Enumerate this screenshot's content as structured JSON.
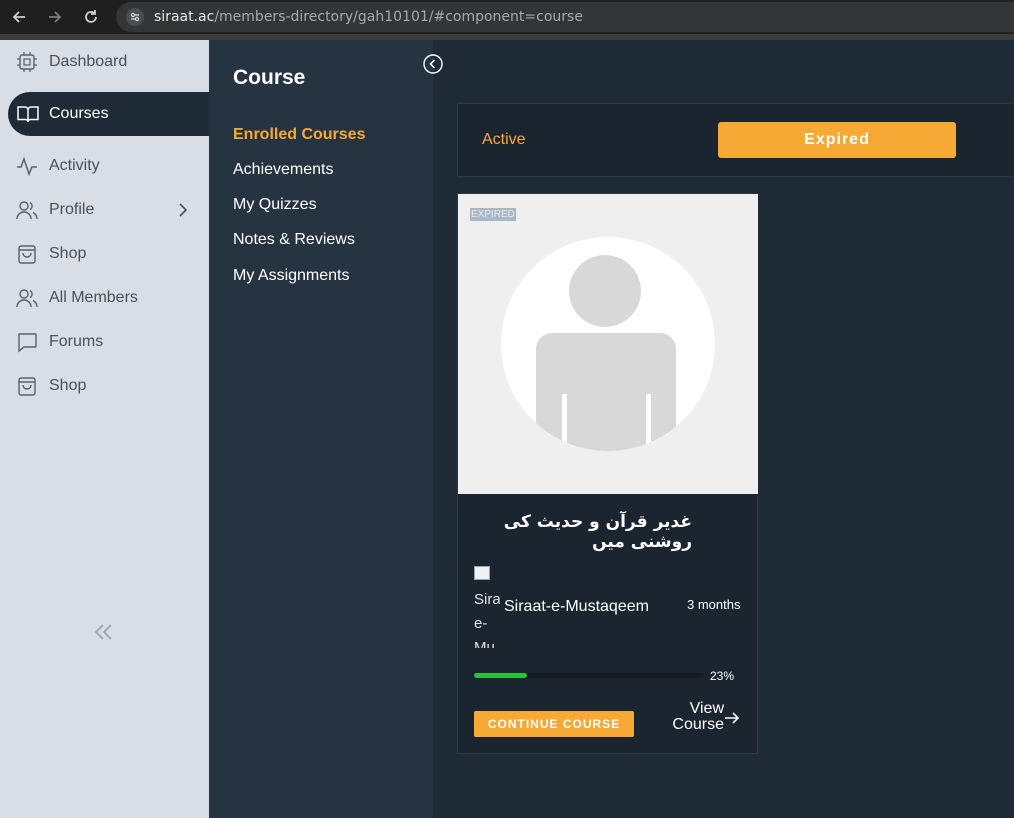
{
  "browser": {
    "url_host": "siraat.ac",
    "url_path": "/members-directory/gah10101/#component=course"
  },
  "sidebar": {
    "items": [
      {
        "label": "Dashboard",
        "icon": "chip-icon"
      },
      {
        "label": "Courses",
        "icon": "book-open-icon",
        "active": true
      },
      {
        "label": "Activity",
        "icon": "activity-icon"
      },
      {
        "label": "Profile",
        "icon": "users-icon"
      },
      {
        "label": "Shop",
        "icon": "shopping-bag-icon"
      },
      {
        "label": "All Members",
        "icon": "users-icon"
      },
      {
        "label": "Forums",
        "icon": "chat-bubble-icon"
      },
      {
        "label": "Shop",
        "icon": "shopping-bag-icon"
      }
    ]
  },
  "course_panel": {
    "title": "Course",
    "menu": [
      {
        "label": "Enrolled Courses",
        "active": true
      },
      {
        "label": "Achievements"
      },
      {
        "label": "My Quizzes"
      },
      {
        "label": "Notes & Reviews"
      },
      {
        "label": "My Assignments"
      }
    ]
  },
  "filters": {
    "active_label": "Active",
    "expired_label": "Expired"
  },
  "course_card": {
    "badge": "EXPIRED",
    "title": "غدیر قرآن و حدیث کی روشنی میں",
    "instructor_img_alt": "Siraat-e-Mu",
    "instructor": "Siraat-e-Mustaqeem",
    "duration": "3 months",
    "progress": 0.23,
    "progress_text": "23%",
    "continue_label": "CONTINUE COURSE",
    "view_label": "View Course"
  },
  "colors": {
    "accent": "#f7a935",
    "sidebar_bg": "#d9dee5",
    "panel_bg": "#263442",
    "main_bg": "#1e2a36",
    "progress": "#26c33b"
  }
}
